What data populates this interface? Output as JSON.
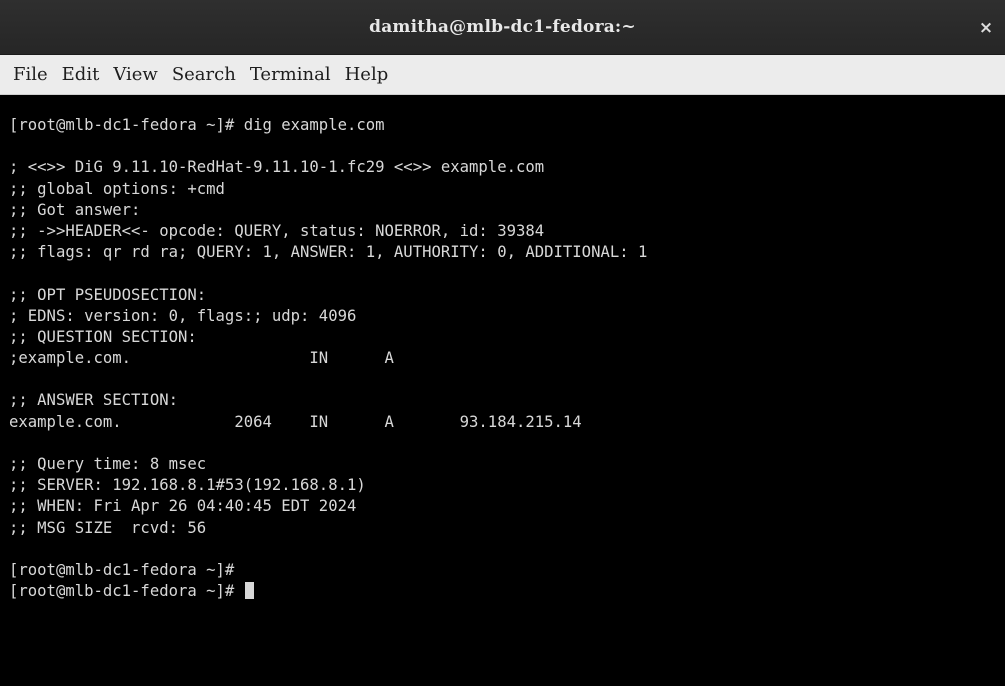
{
  "window": {
    "title": "damitha@mlb-dc1-fedora:~",
    "close_label": "×"
  },
  "menu": [
    "File",
    "Edit",
    "View",
    "Search",
    "Terminal",
    "Help"
  ],
  "terminal": {
    "lines": [
      "",
      "[root@mlb-dc1-fedora ~]# dig example.com",
      "",
      "; <<>> DiG 9.11.10-RedHat-9.11.10-1.fc29 <<>> example.com",
      ";; global options: +cmd",
      ";; Got answer:",
      ";; ->>HEADER<<- opcode: QUERY, status: NOERROR, id: 39384",
      ";; flags: qr rd ra; QUERY: 1, ANSWER: 1, AUTHORITY: 0, ADDITIONAL: 1",
      "",
      ";; OPT PSEUDOSECTION:",
      "; EDNS: version: 0, flags:; udp: 4096",
      ";; QUESTION SECTION:",
      ";example.com.                   IN      A",
      "",
      ";; ANSWER SECTION:",
      "example.com.            2064    IN      A       93.184.215.14",
      "",
      ";; Query time: 8 msec",
      ";; SERVER: 192.168.8.1#53(192.168.8.1)",
      ";; WHEN: Fri Apr 26 04:40:45 EDT 2024",
      ";; MSG SIZE  rcvd: 56",
      "",
      "[root@mlb-dc1-fedora ~]#",
      "[root@mlb-dc1-fedora ~]#"
    ]
  },
  "colors": {
    "terminal_bg": "#000000",
    "terminal_fg": "#d8d8d8",
    "titlebar_bg": "#2c2c2c",
    "menubar_bg": "#ececec"
  }
}
